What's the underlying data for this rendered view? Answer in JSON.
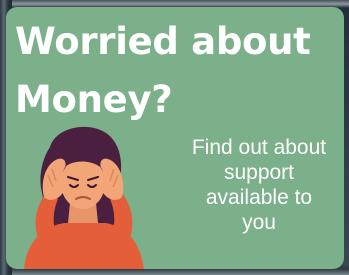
{
  "banner": {
    "headline_line1": "Worried about",
    "headline_line2": "Money?",
    "body_lines": [
      "Find out about",
      "support",
      "available to",
      "you"
    ]
  },
  "colors": {
    "card_background": "#7bb08a",
    "text": "#ffffff",
    "hair": "#4a1f3f",
    "skin": "#f2a577",
    "sweater": "#e45e39"
  },
  "illustration": {
    "icon": "worried-woman-illustration"
  }
}
